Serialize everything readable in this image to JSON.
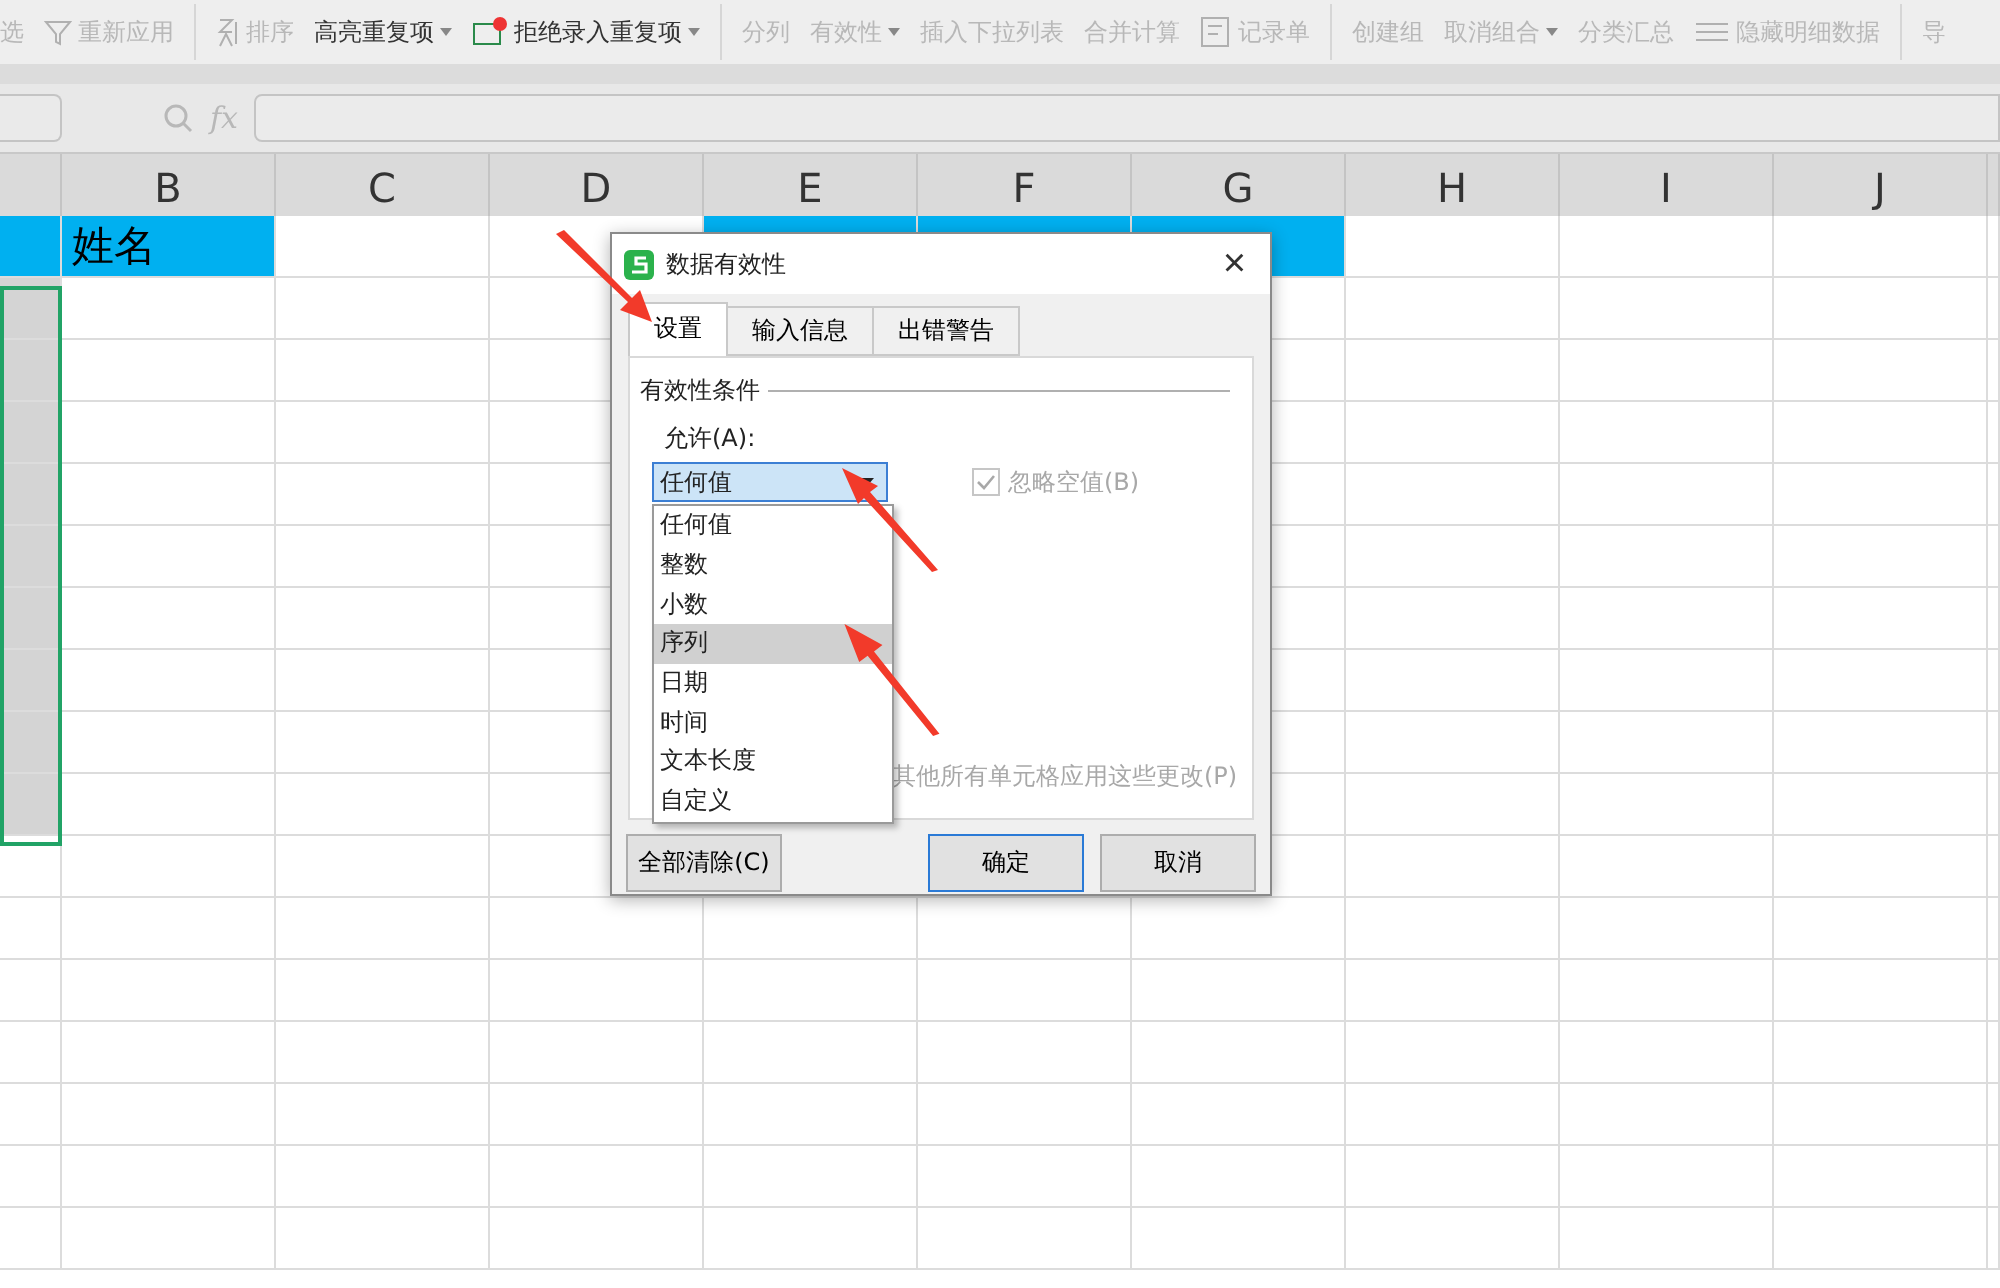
{
  "toolbar": {
    "items": [
      {
        "label": "选",
        "kind": "text",
        "disabled": true
      },
      {
        "label": "重新应用",
        "kind": "filter",
        "disabled": true
      },
      {
        "kind": "separator"
      },
      {
        "label": "排序",
        "kind": "sort",
        "disabled": true
      },
      {
        "label": "高亮重复项",
        "kind": "dropdown",
        "disabled": false
      },
      {
        "label": "拒绝录入重复项",
        "kind": "reject",
        "disabled": false
      },
      {
        "kind": "separator"
      },
      {
        "label": "分列",
        "kind": "text",
        "disabled": true
      },
      {
        "label": "有效性",
        "kind": "dropdown",
        "disabled": true
      },
      {
        "label": "插入下拉列表",
        "kind": "text",
        "disabled": true
      },
      {
        "label": "合并计算",
        "kind": "text",
        "disabled": true
      },
      {
        "label": "记录单",
        "kind": "form",
        "disabled": true
      },
      {
        "kind": "separator"
      },
      {
        "label": "创建组",
        "kind": "text",
        "disabled": true
      },
      {
        "label": "取消组合",
        "kind": "dropdown",
        "disabled": true
      },
      {
        "label": "分类汇总",
        "kind": "text",
        "disabled": true
      },
      {
        "label": "隐藏明细数据",
        "kind": "hide",
        "disabled": true
      },
      {
        "kind": "separator"
      },
      {
        "label": "导",
        "kind": "text",
        "disabled": true
      }
    ]
  },
  "formula_bar": {
    "fx": "fx"
  },
  "sheet": {
    "columns": [
      "B",
      "C",
      "D",
      "E",
      "F",
      "G",
      "H",
      "I",
      "J"
    ],
    "first_row": [
      {
        "color": "#00b0f0"
      },
      {
        "text": "姓名",
        "color": "#00b0f0"
      },
      {
        "color": "#ffffff"
      },
      {
        "color": "#ffffff"
      },
      {
        "color": "#00b0f0"
      },
      {
        "color": "#00b0f0"
      },
      {
        "color": "#00b0f0"
      },
      {
        "color": "#ffffff"
      },
      {
        "color": "#ffffff"
      },
      {
        "color": "#ffffff"
      }
    ],
    "rows": [
      {
        "selected": true
      },
      {
        "selected": true
      },
      {
        "selected": true
      },
      {
        "selected": true
      },
      {
        "selected": true
      },
      {
        "selected": true
      },
      {
        "selected": true
      },
      {
        "selected": true
      },
      {
        "selected": true
      },
      {
        "selected": false
      },
      {
        "selected": false
      },
      {
        "selected": false
      },
      {
        "selected": false
      },
      {
        "selected": false
      },
      {
        "selected": false
      },
      {
        "selected": false
      }
    ]
  },
  "dialog": {
    "title": "数据有效性",
    "close": "×",
    "tabs": [
      {
        "label": "设置",
        "selected": true
      },
      {
        "label": "输入信息",
        "selected": false
      },
      {
        "label": "出错警告",
        "selected": false
      }
    ],
    "group_title": "有效性条件",
    "allow_label": "允许(A):",
    "allow_value": "任何值",
    "dropdown_open": true,
    "ignore_blank": {
      "label": "忽略空值(B)",
      "checked": true,
      "disabled": true
    },
    "options": [
      {
        "label": "任何值",
        "selected": false
      },
      {
        "label": "整数",
        "selected": false
      },
      {
        "label": "小数",
        "selected": false
      },
      {
        "label": "序列",
        "selected": true
      },
      {
        "label": "日期",
        "selected": false
      },
      {
        "label": "时间",
        "selected": false
      },
      {
        "label": "文本长度",
        "selected": false
      },
      {
        "label": "自定义",
        "selected": false
      }
    ],
    "apply_all": "其他所有单元格应用这些更改(P)",
    "buttons": [
      {
        "label": "全部清除(C)",
        "default": false
      },
      {
        "label": "确定",
        "default": true
      },
      {
        "label": "取消",
        "default": false
      }
    ]
  }
}
